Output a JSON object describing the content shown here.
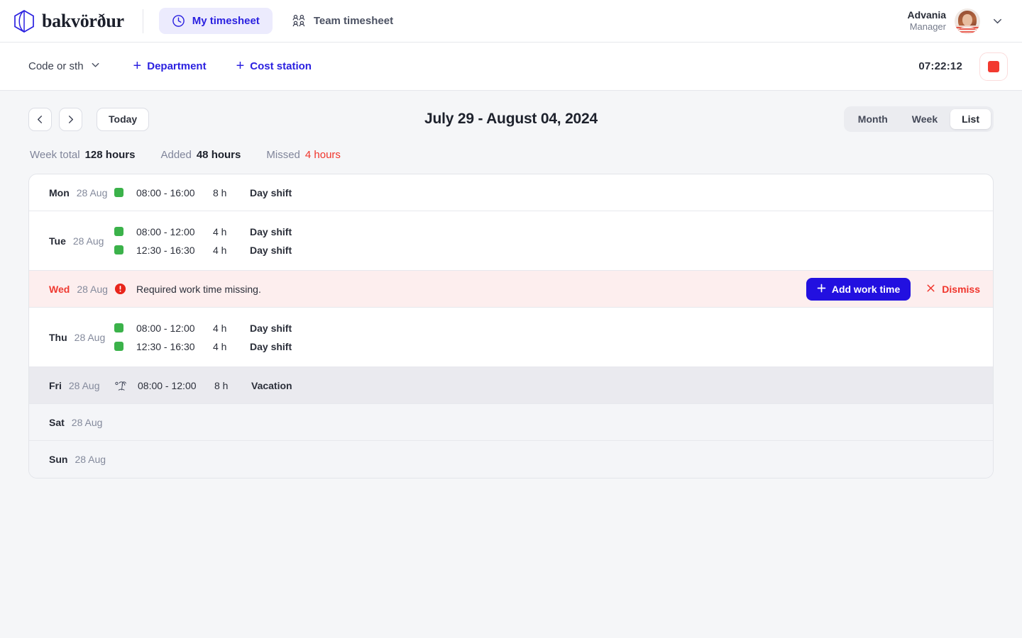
{
  "header": {
    "brand_name": "bakvörður",
    "brand_logo_icon": "hexagon-logo-icon",
    "nav": [
      {
        "label": "My timesheet",
        "icon": "clock-icon",
        "active": true
      },
      {
        "label": "Team timesheet",
        "icon": "people-group-icon",
        "active": false
      }
    ],
    "user": {
      "name": "Advania",
      "role": "Manager",
      "avatar_icon": "user-avatar",
      "caret_icon": "chevron-down-icon"
    }
  },
  "toolbar": {
    "code_select": {
      "label": "Code or sth",
      "icon": "chevron-down-icon"
    },
    "department_button": {
      "label": "Department",
      "icon": "plus-icon"
    },
    "cost_station_button": {
      "label": "Cost station",
      "icon": "plus-icon"
    },
    "timer": "07:22:12",
    "stop_button_icon": "stop-square-icon"
  },
  "controls": {
    "prev_icon": "chevron-left-icon",
    "next_icon": "chevron-right-icon",
    "today_label": "Today",
    "date_range": "July 29 - August 04, 2024",
    "views": [
      {
        "label": "Month",
        "active": false
      },
      {
        "label": "Week",
        "active": false
      },
      {
        "label": "List",
        "active": true
      }
    ]
  },
  "summary": {
    "week_total_label": "Week total",
    "week_total_value": "128 hours",
    "added_label": "Added",
    "added_value": "48 hours",
    "missed_label": "Missed",
    "missed_value": "4 hours"
  },
  "rows": [
    {
      "dow": "Mon",
      "date": "28 Aug",
      "type": "normal",
      "entries": [
        {
          "status_icon": "green-square-icon",
          "time": "08:00 - 16:00",
          "hours": "8 h",
          "shift": "Day shift"
        }
      ]
    },
    {
      "dow": "Tue",
      "date": "28 Aug",
      "type": "normal",
      "entries": [
        {
          "status_icon": "green-square-icon",
          "time": "08:00 - 12:00",
          "hours": "4 h",
          "shift": "Day shift"
        },
        {
          "status_icon": "green-square-icon",
          "time": "12:30 - 16:30",
          "hours": "4 h",
          "shift": "Day shift"
        }
      ]
    },
    {
      "dow": "Wed",
      "date": "28 Aug",
      "type": "alert",
      "alert": {
        "icon": "error-circle-icon",
        "message": "Required work time missing.",
        "add_label": "Add work time",
        "add_icon": "plus-icon",
        "dismiss_label": "Dismiss",
        "dismiss_icon": "close-x-icon"
      }
    },
    {
      "dow": "Thu",
      "date": "28 Aug",
      "type": "normal",
      "entries": [
        {
          "status_icon": "green-square-icon",
          "time": "08:00 - 12:00",
          "hours": "4 h",
          "shift": "Day shift"
        },
        {
          "status_icon": "green-square-icon",
          "time": "12:30 - 16:30",
          "hours": "4 h",
          "shift": "Day shift"
        }
      ]
    },
    {
      "dow": "Fri",
      "date": "28 Aug",
      "type": "vacation",
      "entries": [
        {
          "status_icon": "palm-tree-icon",
          "time": "08:00 - 12:00",
          "hours": "8 h",
          "shift": "Vacation"
        }
      ]
    },
    {
      "dow": "Sat",
      "date": "28 Aug",
      "type": "weekend",
      "entries": []
    },
    {
      "dow": "Sun",
      "date": "28 Aug",
      "type": "weekend",
      "entries": []
    }
  ],
  "colors": {
    "accent_blue": "#2210e0",
    "nav_active_bg": "#ecebfd",
    "status_green": "#3bb24a",
    "alert_red": "#f0342b",
    "alert_row_bg": "#fdeeee",
    "vacation_row_bg": "#eaeaef",
    "weekend_row_bg": "#f4f5f8",
    "page_bg": "#f5f6f8"
  }
}
